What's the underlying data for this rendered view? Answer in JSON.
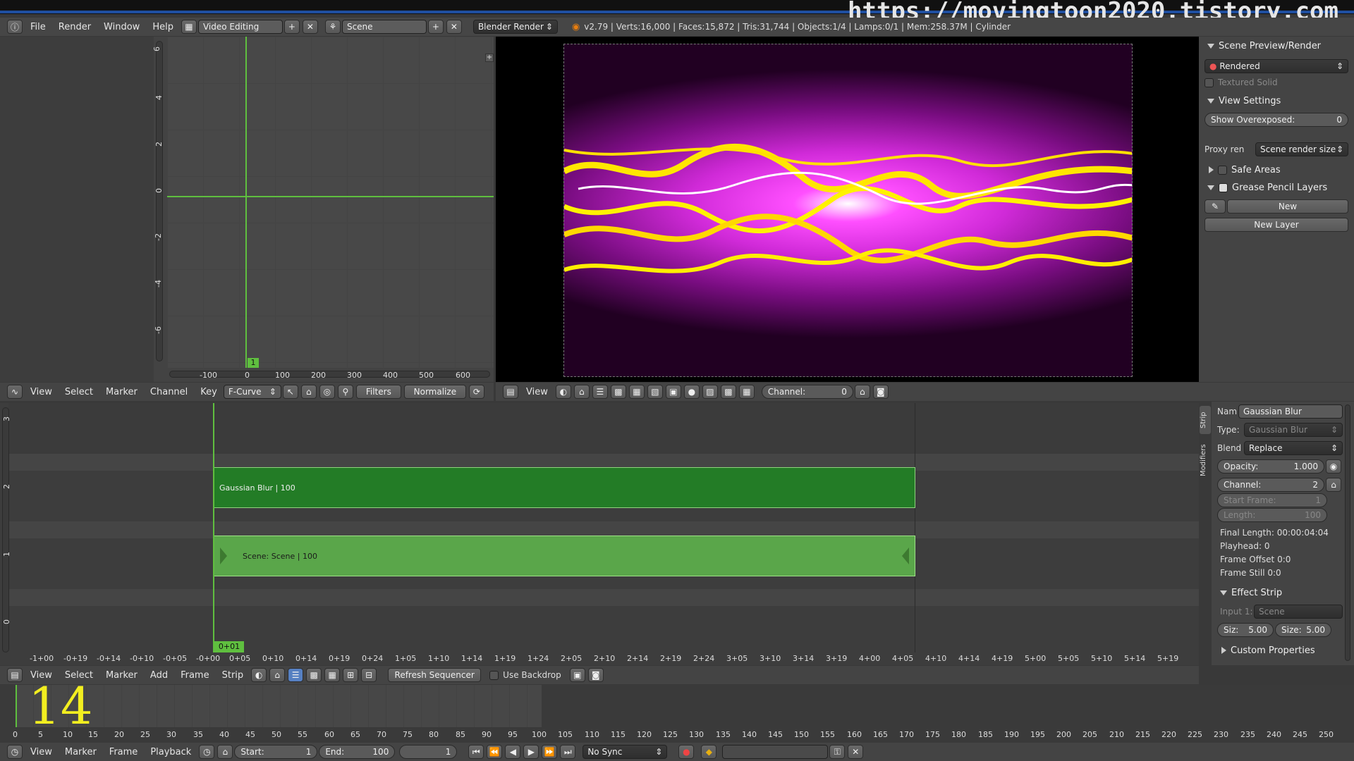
{
  "watermark": "https://movingtoon2020.tistory.com",
  "top": {
    "menus": [
      "File",
      "Render",
      "Window",
      "Help"
    ],
    "layout": "Video Editing",
    "scene": "Scene",
    "engine": "Blender Render",
    "stats": "v2.79 | Verts:16,000 | Faces:15,872 | Tris:31,744 | Objects:1/4 | Lamps:0/1 | Mem:258.37M | Cylinder"
  },
  "graph": {
    "yticks": [
      "6",
      "4",
      "2",
      "0",
      "-2",
      "-4",
      "-6"
    ],
    "xticks": [
      "-100",
      "0",
      "100",
      "200",
      "300",
      "400",
      "500",
      "600"
    ],
    "frame": "1"
  },
  "graph_header": {
    "menus": [
      "View",
      "Select",
      "Marker",
      "Channel",
      "Key"
    ],
    "mode": "F-Curve",
    "filters": "Filters",
    "normalize": "Normalize"
  },
  "preview_header": {
    "view": "View",
    "channel_label": "Channel:",
    "channel_value": "0"
  },
  "props": {
    "scene_preview": "Scene Preview/Render",
    "rendered": "Rendered",
    "textured_solid": "Textured Solid",
    "view_settings": "View Settings",
    "show_overexposed_label": "Show Overexposed:",
    "show_overexposed_value": "0",
    "proxy_label": "Proxy ren",
    "proxy_value": "Scene render size",
    "safe_areas": "Safe Areas",
    "grease_pencil": "Grease Pencil Layers",
    "new": "New",
    "new_layer": "New Layer"
  },
  "sequencer": {
    "channels": [
      "3",
      "2",
      "1",
      "0"
    ],
    "strip1": "Gaussian Blur | 100",
    "strip2": "Scene: Scene | 100",
    "playhead": "0+01",
    "time_ticks": [
      "-1+00",
      "-0+19",
      "-0+14",
      "-0+10",
      "-0+05",
      "-0+00",
      "0+05",
      "0+10",
      "0+14",
      "0+19",
      "0+24",
      "1+05",
      "1+10",
      "1+14",
      "1+19",
      "1+24",
      "2+05",
      "2+10",
      "2+14",
      "2+19",
      "2+24",
      "3+05",
      "3+10",
      "3+14",
      "3+19",
      "4+00",
      "4+05",
      "4+10",
      "4+14",
      "4+19",
      "5+00",
      "5+05",
      "5+10",
      "5+14",
      "5+19"
    ]
  },
  "strip_panel": {
    "tabs": [
      "Strip",
      "Modifiers"
    ],
    "name_label": "Nam",
    "name_value": "Gaussian Blur",
    "type_label": "Type:",
    "type_value": "Gaussian Blur",
    "blend_label": "Blend",
    "blend_value": "Replace",
    "opacity_label": "Opacity:",
    "opacity_value": "1.000",
    "channel_label": "Channel:",
    "channel_value": "2",
    "start_label": "Start Frame:",
    "start_value": "1",
    "length_label": "Length:",
    "length_value": "100",
    "final_length": "Final Length: 00:00:04:04",
    "playhead": "Playhead: 0",
    "frame_offset": "Frame Offset 0:0",
    "frame_still": "Frame Still 0:0",
    "effect_strip": "Effect Strip",
    "input_label": "Input 1:",
    "input_value": "Scene",
    "siz_label": "Siz:",
    "siz_value": "5.00",
    "size_label": "Size:",
    "size_value": "5.00",
    "custom_props": "Custom Properties"
  },
  "seq_header": {
    "menus": [
      "View",
      "Select",
      "Marker",
      "Add",
      "Frame",
      "Strip"
    ],
    "refresh": "Refresh Sequencer",
    "backdrop": "Use Backdrop"
  },
  "timeline": {
    "big_number": "14",
    "ticks": [
      "0",
      "5",
      "10",
      "15",
      "20",
      "25",
      "30",
      "35",
      "40",
      "45",
      "50",
      "55",
      "60",
      "65",
      "70",
      "75",
      "80",
      "85",
      "90",
      "95",
      "100",
      "105",
      "110",
      "115",
      "120",
      "125",
      "130",
      "135",
      "140",
      "145",
      "150",
      "155",
      "160",
      "165",
      "170",
      "175",
      "180",
      "185",
      "190",
      "195",
      "200",
      "205",
      "210",
      "215",
      "220",
      "225",
      "230",
      "235",
      "240",
      "245",
      "250"
    ]
  },
  "bottom": {
    "menus": [
      "View",
      "Marker",
      "Frame",
      "Playback"
    ],
    "start_label": "Start:",
    "start_value": "1",
    "end_label": "End:",
    "end_value": "100",
    "current": "1",
    "sync": "No Sync"
  }
}
